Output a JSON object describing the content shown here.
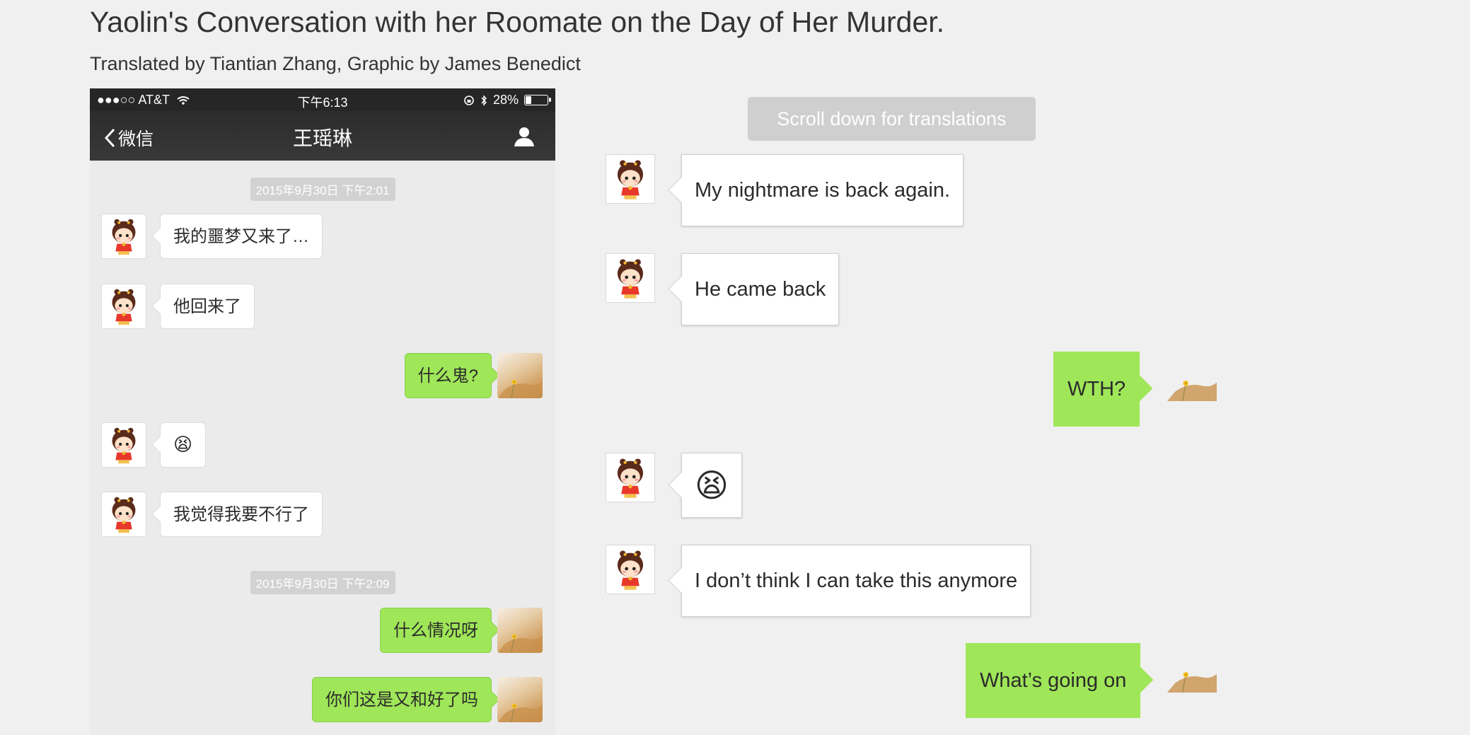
{
  "header": {
    "title": "Yaolin's Conversation with her Roomate on the Day of Her Murder.",
    "subtitle": "Translated by Tiantian Zhang, Graphic by James Benedict"
  },
  "phone": {
    "status": {
      "carrier": "●●●○○ AT&T",
      "time": "下午6:13",
      "battery": "28%",
      "battery_level": 0.28
    },
    "nav": {
      "back_label": "微信",
      "contact_name": "王瑶琳"
    },
    "timestamps": [
      "2015年9月30日 下午2:01",
      "2015年9月30日 下午2:09"
    ],
    "messages": [
      {
        "from": "them",
        "text": "我的噩梦又来了…"
      },
      {
        "from": "them",
        "text": "他回来了"
      },
      {
        "from": "me",
        "text": "什么鬼?"
      },
      {
        "from": "them",
        "text": "😫"
      },
      {
        "from": "them",
        "text": "我觉得我要不行了"
      },
      {
        "from": "me",
        "text": "什么情况呀"
      },
      {
        "from": "me",
        "text": "你们这是又和好了吗"
      }
    ]
  },
  "translation": {
    "banner": "Scroll down for translations",
    "messages": [
      {
        "from": "them",
        "text": "My nightmare is back again."
      },
      {
        "from": "them",
        "text": "He came back"
      },
      {
        "from": "me",
        "text": "WTH?"
      },
      {
        "from": "them",
        "text": "😫"
      },
      {
        "from": "them",
        "text": "I don’t think I can take this anymore"
      },
      {
        "from": "me",
        "text": "What’s going on"
      }
    ]
  },
  "colors": {
    "sent_bubble": "#9fe658",
    "received_bubble": "#ffffff",
    "nav_bar": "#2c2c2c",
    "background": "#f0f0f0"
  }
}
